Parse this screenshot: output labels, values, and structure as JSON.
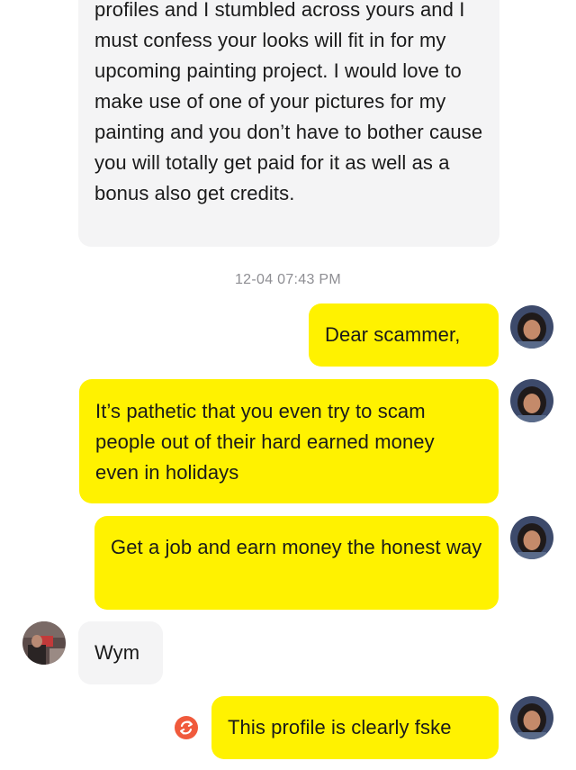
{
  "messages": {
    "first": {
      "text": "profiles and I stumbled across yours and I must confess your looks will fit in for my upcoming painting project. I would love to make use of one of your pictures for my painting and you don’t have to bother cause you will totally get paid for it as well as a bonus also get credits."
    },
    "timestamp": "12-04 07:43 PM",
    "m1": {
      "text": "Dear scammer,"
    },
    "m2": {
      "text": "It’s pathetic that you even try to scam people out of their hard earned money even in holidays"
    },
    "m3": {
      "text": "Get a job and earn money the honest way"
    },
    "m4": {
      "text": "Wym"
    },
    "m5": {
      "text": "This profile is clearly fske"
    }
  },
  "colors": {
    "outgoing_bubble": "#fff200",
    "incoming_bubble": "#f4f4f5",
    "timestamp": "#8e8e93",
    "resend_icon": "#f05a3c"
  },
  "icons": {
    "resend": "refresh-icon"
  }
}
